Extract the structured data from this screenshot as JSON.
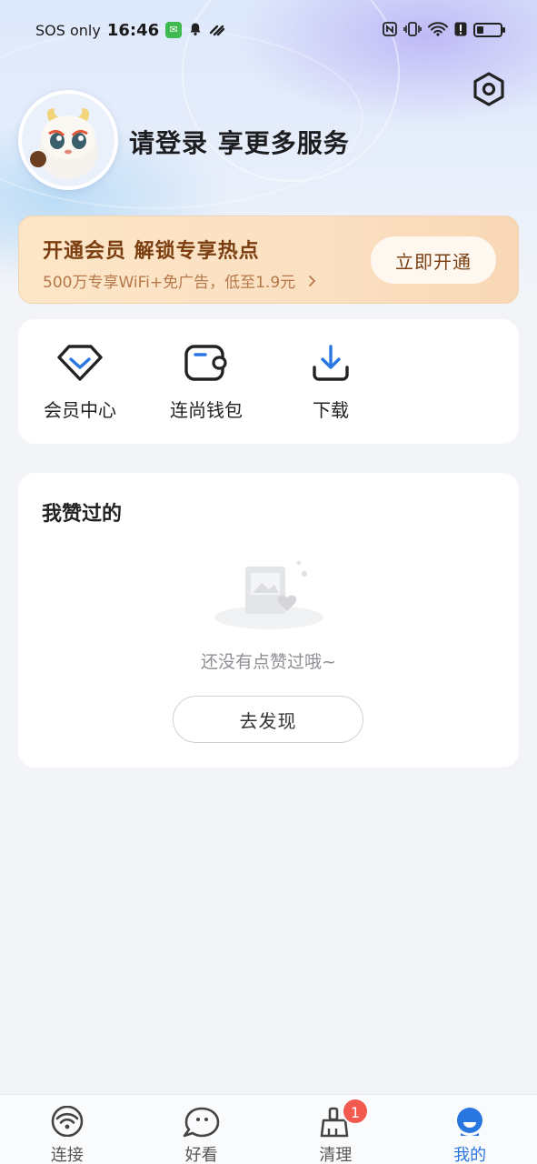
{
  "status_bar": {
    "carrier": "SOS only",
    "time": "16:46",
    "wechat_glyph": "✉",
    "icons": [
      "bell-icon",
      "link-icon",
      "nfc-icon",
      "vibrate-icon",
      "wifi-icon",
      "alert-icon",
      "battery-icon"
    ],
    "battery_level": 0.3
  },
  "profile": {
    "login_prompt": "请登录 享更多服务"
  },
  "vip_banner": {
    "title": "开通会员 解锁专享热点",
    "subtitle": "500万专享WiFi+免广告，低至1.9元",
    "button_label": "立即开通",
    "accent_color": "#7a3e10"
  },
  "quick_actions": [
    {
      "label": "会员中心",
      "icon": "diamond-icon"
    },
    {
      "label": "连尚钱包",
      "icon": "wallet-icon"
    },
    {
      "label": "下载",
      "icon": "download-icon"
    }
  ],
  "liked": {
    "title": "我赞过的",
    "empty_text": "还没有点赞过哦~",
    "discover_button": "去发现"
  },
  "bottom_nav": {
    "items": [
      {
        "label": "连接",
        "icon": "wifi-icon"
      },
      {
        "label": "好看",
        "icon": "chat-face-icon"
      },
      {
        "label": "清理",
        "icon": "broom-icon"
      },
      {
        "label": "我的",
        "icon": "profile-icon"
      }
    ],
    "active_index": 3,
    "clean_badge": "1",
    "active_color": "#2a76e0"
  }
}
